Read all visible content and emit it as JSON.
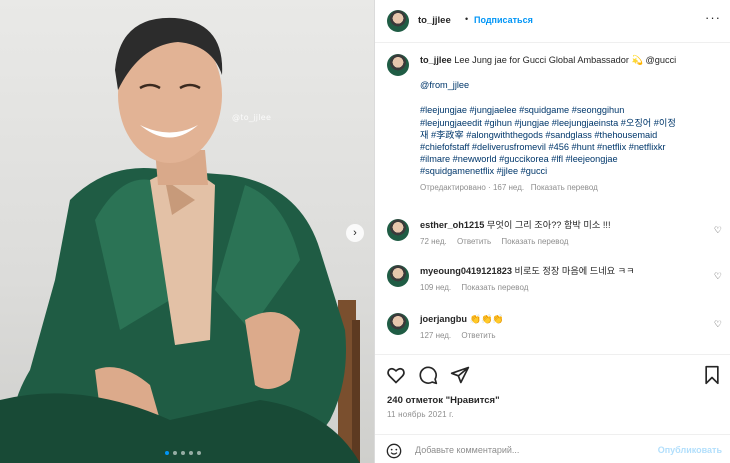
{
  "photo": {
    "watermark": "@to_jjlee"
  },
  "header": {
    "username": "to_jjlee",
    "bullet": "•",
    "follow_label": "Подписаться",
    "more_label": "···"
  },
  "caption": {
    "username": "to_jjlee",
    "text": "Lee Jung jae for Gucci Global Ambassador 💫 @gucci",
    "credit": "@from_jjlee",
    "hashtag_lines": [
      "#leejungjae #jungjaelee #squidgame #seonggihun",
      "#leejungjaeedit #gihun #jungjae #leejungjaeinsta #오징어 #이정",
      "재 #李政宰 #alongwiththegods #sandglass #thehousemaid",
      "#chiefofstaff #deliverusfromevil #456 #hunt #netflix #netflixkr",
      "#ilmare #newworld #guccikorea #lfl #leejeongjae",
      "#squidgamenetflix #jjlee #gucci"
    ],
    "edited_label": "Отредактировано",
    "age": "167 нед.",
    "translate_label": "Показать перевод"
  },
  "comments": [
    {
      "username": "esther_oh1215",
      "text": "무엇이 그리 조아?? 함박 미소 !!!",
      "age": "72 нед.",
      "reply_label": "Ответить",
      "translate_label": "Показать перевод"
    },
    {
      "username": "myeoung0419121823",
      "text": "비로도 정장 마음에 드네요 ㅋㅋ",
      "age": "109 нед.",
      "reply_label": "",
      "translate_label": "Показать перевод"
    },
    {
      "username": "joerjangbu",
      "text": "👏👏👏",
      "age": "127 нед.",
      "reply_label": "Ответить",
      "translate_label": ""
    }
  ],
  "actions": {
    "likes": "240 отметок \"Нравится\"",
    "date": "11 ноябрь 2021 г."
  },
  "add_comment": {
    "placeholder": "Добавьте комментарий...",
    "post_label": "Опубликовать"
  },
  "colors": {
    "accent": "#0095f6",
    "link": "#00376b",
    "muted": "#8e8e8e",
    "suit_green": "#1f5c44"
  },
  "icons": [
    "heart-icon",
    "comment-icon",
    "share-icon",
    "bookmark-icon",
    "emoji-icon",
    "more-icon",
    "chevron-right-icon"
  ]
}
